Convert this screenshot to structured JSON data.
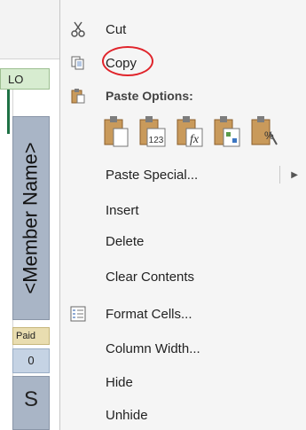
{
  "sheet": {
    "column_header": "LO",
    "member_name_header": "<Member Name>",
    "paid_label": "Paid",
    "zero_value": "0",
    "s_value": "S"
  },
  "context_menu": {
    "cut": {
      "label": "Cut",
      "icon": "scissors-icon"
    },
    "copy": {
      "label": "Copy",
      "icon": "copy-icon",
      "highlight_color": "#e0242b"
    },
    "paste_options": {
      "label": "Paste Options:",
      "icon": "clipboard-icon"
    },
    "paste_special": {
      "label": "Paste Special...",
      "has_submenu": true
    },
    "insert": {
      "label": "Insert"
    },
    "delete": {
      "label": "Delete"
    },
    "clear_contents": {
      "label": "Clear Contents"
    },
    "format_cells": {
      "label": "Format Cells...",
      "icon": "format-cells-icon"
    },
    "column_width": {
      "label": "Column Width..."
    },
    "hide": {
      "label": "Hide"
    },
    "unhide": {
      "label": "Unhide"
    }
  },
  "colors": {
    "menu_bg": "#f5f5f5",
    "header_green": "#d7ecd0",
    "member_cell": "#a9b5c6",
    "paid_cell": "#e9ddb0",
    "clipboard_brown": "#b8864b"
  }
}
